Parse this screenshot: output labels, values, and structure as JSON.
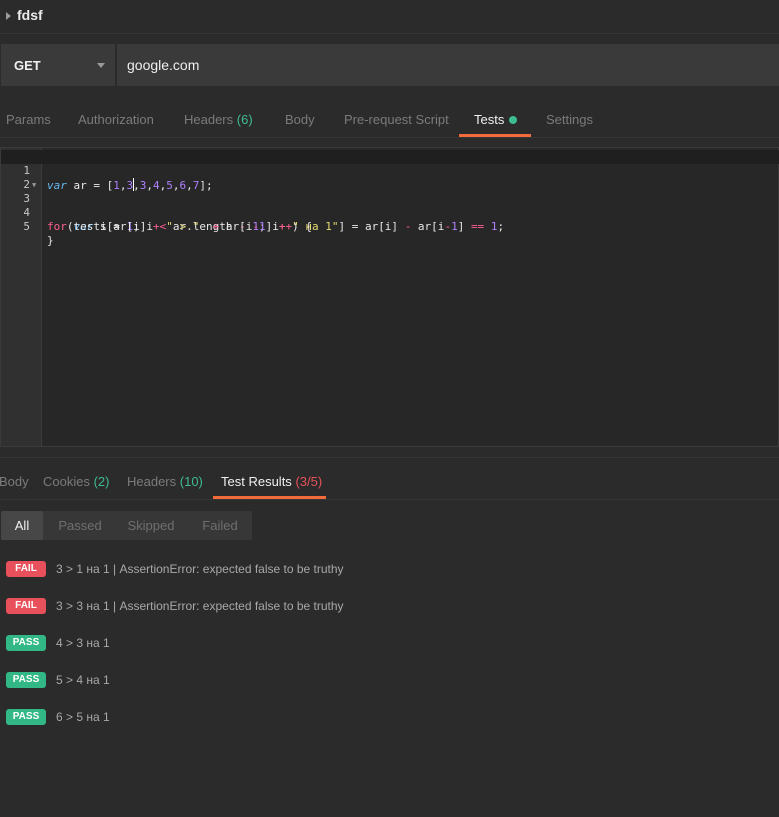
{
  "request": {
    "name": "fdsf",
    "method": "GET",
    "url": "google.com"
  },
  "request_tabs": [
    {
      "label": "Params"
    },
    {
      "label": "Authorization"
    },
    {
      "label": "Headers",
      "count": "(6)"
    },
    {
      "label": "Body"
    },
    {
      "label": "Pre-request Script"
    },
    {
      "label": "Tests",
      "active": true
    },
    {
      "label": "Settings"
    }
  ],
  "editor": {
    "line_numbers": [
      "1",
      "2",
      "3",
      "4",
      "5"
    ],
    "lines": [
      "var ar = [1,3,3,4,5,6,7];",
      "",
      "for(var i = 1; i < ar.length - 1; i++) {",
      "    tests[ar[i] + \" > \"  + ar[i-1] + \" на 1\"] = ar[i] - ar[i-1] == 1;",
      "}"
    ]
  },
  "response_tabs": [
    {
      "label": "Body"
    },
    {
      "label": "Cookies",
      "count": "(2)"
    },
    {
      "label": "Headers",
      "count": "(10)"
    },
    {
      "label": "Test Results",
      "count": "(3/5)",
      "active": true
    }
  ],
  "filters": [
    "All",
    "Passed",
    "Skipped",
    "Failed"
  ],
  "results": [
    {
      "status": "FAIL",
      "text": "3 > 1 на 1 | AssertionError: expected false to be truthy"
    },
    {
      "status": "FAIL",
      "text": "3 > 3 на 1 | AssertionError: expected false to be truthy"
    },
    {
      "status": "PASS",
      "text": "4 > 3 на 1"
    },
    {
      "status": "PASS",
      "text": "5 > 4 на 1"
    },
    {
      "status": "PASS",
      "text": "6 > 5 на 1"
    }
  ],
  "colors": {
    "accent": "#f26b3a",
    "pass": "#31b886",
    "fail": "#e8505b",
    "count_green": "#3dbd8f"
  }
}
